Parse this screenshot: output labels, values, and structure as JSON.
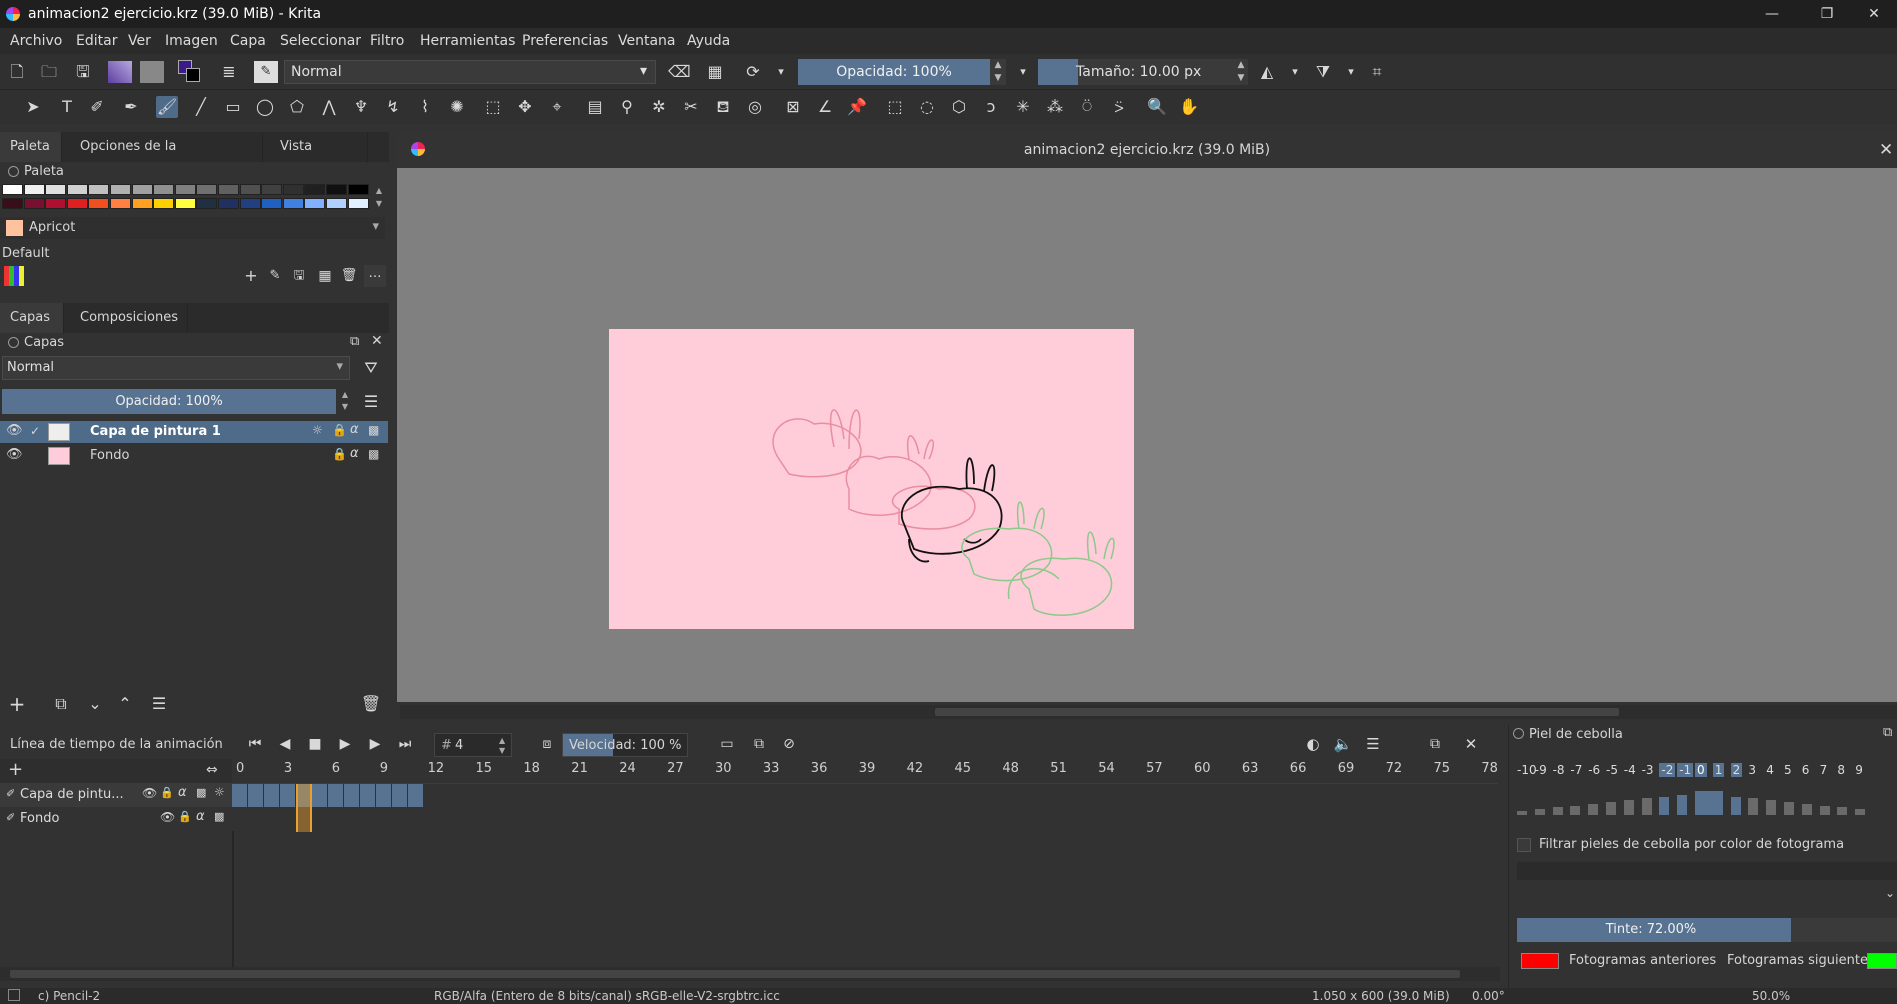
{
  "window": {
    "title": "animacion2 ejercicio.krz (39.0 MiB) - Krita",
    "minimize": "—",
    "maximize": "❐",
    "close": "✕"
  },
  "menu": [
    "Archivo",
    "Editar",
    "Ver",
    "Imagen",
    "Capa",
    "Seleccionar",
    "Filtro",
    "Herramientas",
    "Preferencias",
    "Ventana",
    "Ayuda"
  ],
  "toolbar": {
    "blend_mode": "Normal",
    "opacity": "Opacidad: 100%",
    "size": "Tamaño: 10.00 px"
  },
  "docker_tabs": [
    "Paleta",
    "Opciones de la herramienta",
    "Vista general"
  ],
  "palette": {
    "title": "Paleta",
    "current_color_name": "Apricot",
    "current_color": "#ffc29e",
    "set_name": "Default",
    "row1": [
      "#ffffff",
      "#f0f0f0",
      "#e0e0e0",
      "#d0d0d0",
      "#c0c0c0",
      "#b0b0b0",
      "#a0a0a0",
      "#909090",
      "#808080",
      "#707070",
      "#606060",
      "#505050",
      "#404040",
      "#303030",
      "#202020",
      "#101010",
      "#000000"
    ],
    "row2": [
      "#3a0d1a",
      "#7a1030",
      "#b01030",
      "#e02020",
      "#f05020",
      "#ff8040",
      "#ffa020",
      "#ffd000",
      "#ffff40",
      "#203040",
      "#203060",
      "#204080",
      "#2060c0",
      "#4080e0",
      "#80b0ff",
      "#b0d0ff",
      "#e0f0ff"
    ]
  },
  "layers_tabs": [
    "Capas",
    "Composiciones"
  ],
  "layers": {
    "title": "Capas",
    "blend": "Normal",
    "opacity": "Opacidad:  100%",
    "items": [
      {
        "name": "Capa de pintura 1"
      },
      {
        "name": "Fondo"
      }
    ]
  },
  "document": {
    "title": "animacion2 ejercicio.krz (39.0 MiB)",
    "canvas_color": "#ffccd9"
  },
  "timeline": {
    "title": "Línea de tiempo de la animación",
    "frame": "4",
    "frame_prefix": "#",
    "speed": "Velocidad: 100 %",
    "ticks": [
      "0",
      "3",
      "6",
      "9",
      "12",
      "15",
      "18",
      "21",
      "24",
      "27",
      "30",
      "33",
      "36",
      "39",
      "42",
      "45",
      "48",
      "51",
      "54",
      "57",
      "60",
      "63",
      "66",
      "69",
      "72",
      "75",
      "78"
    ],
    "layers": [
      "Capa de pintu...",
      "Fondo"
    ]
  },
  "onion": {
    "title": "Piel de cebolla",
    "numbers": [
      "-10",
      "-9",
      "-8",
      "-7",
      "-6",
      "-5",
      "-4",
      "-3",
      "-2",
      "-1",
      "0",
      "1",
      "2",
      "3",
      "4",
      "5",
      "6",
      "7",
      "8",
      "9"
    ],
    "filter_label": "Filtrar pieles de cebolla por color de fotograma",
    "tint": "Tinte: 72.00%",
    "tint_level": 0.72,
    "prev_label": "Fotogramas anteriores",
    "next_label": "Fotogramas siguientes",
    "prev_color": "#ff0000",
    "next_color": "#00ff00"
  },
  "status": {
    "brush": "c) Pencil-2",
    "color_space": "RGB/Alfa (Entero de 8 bits/canal)  sRGB-elle-V2-srgbtrc.icc",
    "size": "1.050 x 600 (39.0 MiB)",
    "rotation": "0.00°",
    "zoom": "50.0%"
  }
}
